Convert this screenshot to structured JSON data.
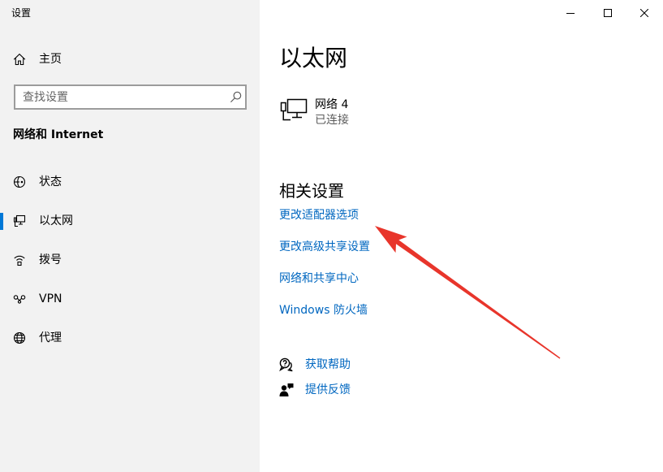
{
  "window": {
    "title": "设置",
    "controls": [
      "minimize-icon",
      "maximize-icon",
      "close-icon"
    ]
  },
  "sidebar": {
    "home": {
      "label": "主页",
      "icon": "home-icon"
    },
    "search": {
      "placeholder": "查找设置",
      "value": "",
      "icon": "search-icon"
    },
    "section_title": "网络和 Internet",
    "items": [
      {
        "label": "状态",
        "icon": "network-status-icon",
        "selected": false
      },
      {
        "label": "以太网",
        "icon": "ethernet-icon",
        "selected": true
      },
      {
        "label": "拨号",
        "icon": "dial-up-icon",
        "selected": false
      },
      {
        "label": "VPN",
        "icon": "vpn-icon",
        "selected": false
      },
      {
        "label": "代理",
        "icon": "proxy-globe-icon",
        "selected": false
      }
    ]
  },
  "main": {
    "title": "以太网",
    "network": {
      "name": "网络 4",
      "status": "已连接",
      "icon": "ethernet-network-icon"
    },
    "related_settings": {
      "title": "相关设置",
      "links": [
        "更改适配器选项",
        "更改高级共享设置",
        "网络和共享中心",
        "Windows 防火墙"
      ]
    },
    "support": [
      {
        "label": "获取帮助",
        "icon": "get-help-icon"
      },
      {
        "label": "提供反馈",
        "icon": "feedback-icon"
      }
    ]
  },
  "colors": {
    "sidebar_bg": "#f2f2f2",
    "accent": "#0078d7",
    "link": "#0067c0",
    "secondary_text": "#5c5c5c",
    "annotation_arrow": "#e8352b"
  }
}
